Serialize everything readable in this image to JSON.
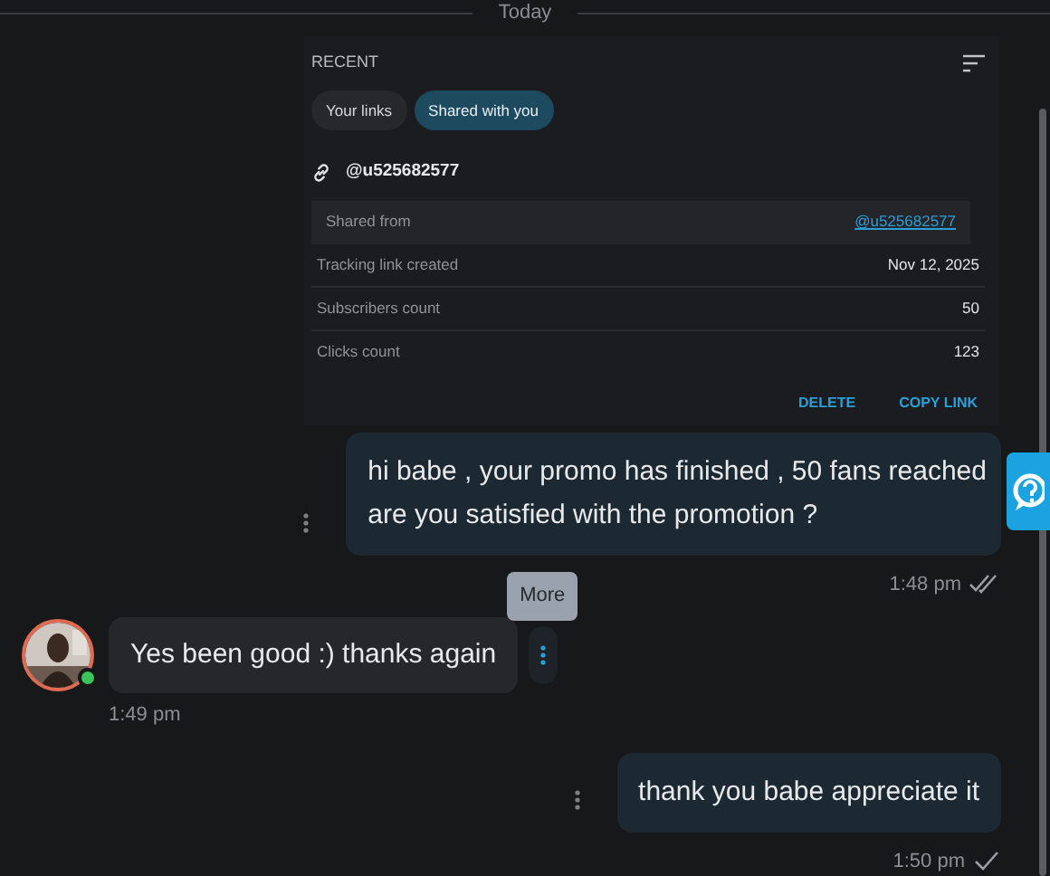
{
  "date_divider": "Today",
  "shared_link_card": {
    "heading": "RECENT",
    "tabs": [
      {
        "label": "Your links",
        "selected": false
      },
      {
        "label": "Shared with you",
        "selected": true
      }
    ],
    "link_name": "@u525682577",
    "details": [
      {
        "label": "Shared from",
        "value": "@u525682577",
        "kind": "link"
      },
      {
        "label": "Tracking link created",
        "value": "Nov 12, 2025",
        "kind": "plain"
      },
      {
        "label": "Subscribers count",
        "value": "50",
        "kind": "plain"
      },
      {
        "label": "Clicks count",
        "value": "123",
        "kind": "plain"
      }
    ],
    "actions": [
      "DELETE",
      "COPY LINK"
    ]
  },
  "messages": [
    {
      "kind": "outgoing",
      "text": "hi babe , your promo has finished , 50 fans reached\nare you satisfied with the promotion ?",
      "time": "1:48 pm",
      "read": true
    },
    {
      "kind": "incoming",
      "text": "Yes been good :) thanks again",
      "time": "1:49 pm",
      "online": true,
      "menu_tooltip": "More"
    },
    {
      "kind": "outgoing",
      "text": "thank you babe appreciate it",
      "time": "1:50 pm",
      "read": false
    }
  ]
}
